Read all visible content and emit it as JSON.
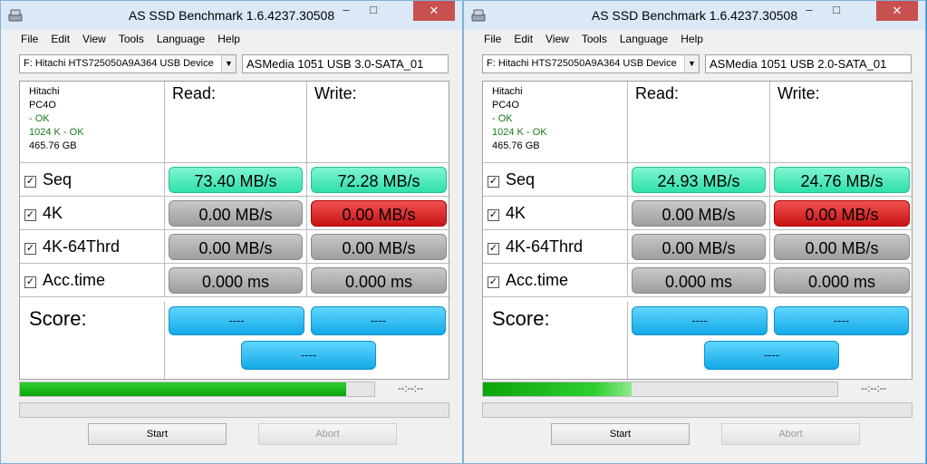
{
  "windows": [
    {
      "title": "AS SSD Benchmark 1.6.4237.30508",
      "menu": [
        "File",
        "Edit",
        "View",
        "Tools",
        "Language",
        "Help"
      ],
      "device": "F: Hitachi HTS725050A9A364 USB Device",
      "controller": "ASMedia 1051 USB 3.0-SATA_01",
      "info": {
        "vendor": "Hitachi",
        "model": "PC4O",
        "status1": " - OK",
        "status2": "1024 K - OK",
        "capacity": "465.76 GB"
      },
      "read_label": "Read:",
      "write_label": "Write:",
      "rows": [
        {
          "label": "Seq",
          "read": "73.40 MB/s",
          "write": "72.28 MB/s",
          "read_color": "green",
          "write_color": "green"
        },
        {
          "label": "4K",
          "read": "0.00 MB/s",
          "write": "0.00 MB/s",
          "read_color": "grey",
          "write_color": "red"
        },
        {
          "label": "4K-64Thrd",
          "read": "0.00 MB/s",
          "write": "0.00 MB/s",
          "read_color": "grey",
          "write_color": "grey"
        },
        {
          "label": "Acc.time",
          "read": "0.000 ms",
          "write": "0.000 ms",
          "read_color": "grey",
          "write_color": "grey"
        }
      ],
      "score_label": "Score:",
      "score_read": "----",
      "score_write": "----",
      "score_total": "----",
      "progress": 0.92,
      "eta": "--:--:--",
      "start": "Start",
      "abort": "Abort"
    },
    {
      "title": "AS SSD Benchmark 1.6.4237.30508",
      "menu": [
        "File",
        "Edit",
        "View",
        "Tools",
        "Language",
        "Help"
      ],
      "device": "F: Hitachi HTS725050A9A364 USB Device",
      "controller": "ASMedia 1051 USB 2.0-SATA_01",
      "info": {
        "vendor": "Hitachi",
        "model": "PC4O",
        "status1": " - OK",
        "status2": "1024 K - OK",
        "capacity": "465.76 GB"
      },
      "read_label": "Read:",
      "write_label": "Write:",
      "rows": [
        {
          "label": "Seq",
          "read": "24.93 MB/s",
          "write": "24.76 MB/s",
          "read_color": "green",
          "write_color": "green"
        },
        {
          "label": "4K",
          "read": "0.00 MB/s",
          "write": "0.00 MB/s",
          "read_color": "grey",
          "write_color": "red"
        },
        {
          "label": "4K-64Thrd",
          "read": "0.00 MB/s",
          "write": "0.00 MB/s",
          "read_color": "grey",
          "write_color": "grey"
        },
        {
          "label": "Acc.time",
          "read": "0.000 ms",
          "write": "0.000 ms",
          "read_color": "grey",
          "write_color": "grey"
        }
      ],
      "score_label": "Score:",
      "score_read": "----",
      "score_write": "----",
      "score_total": "----",
      "progress": 0.42,
      "eta": "--:--:--",
      "start": "Start",
      "abort": "Abort"
    }
  ]
}
